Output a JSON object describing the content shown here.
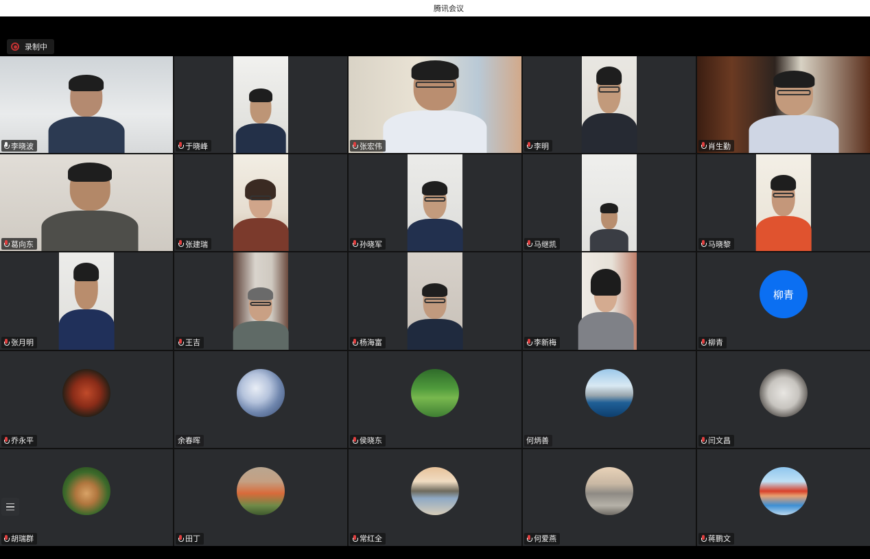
{
  "app": {
    "title": "腾讯会议"
  },
  "recording": {
    "label": "录制中",
    "icon": "record-icon"
  },
  "participants": [
    {
      "name": "李晓波",
      "mic": "on"
    },
    {
      "name": "于晓峰",
      "mic": "muted"
    },
    {
      "name": "张宏伟",
      "mic": "muted"
    },
    {
      "name": "李明",
      "mic": "muted"
    },
    {
      "name": "肖生勤",
      "mic": "muted"
    },
    {
      "name": "葛向东",
      "mic": "muted"
    },
    {
      "name": "张建瑞",
      "mic": "muted"
    },
    {
      "name": "孙晓军",
      "mic": "muted"
    },
    {
      "name": "马继凯",
      "mic": "muted"
    },
    {
      "name": "马晓黎",
      "mic": "muted"
    },
    {
      "name": "张月明",
      "mic": "muted"
    },
    {
      "name": "王吉",
      "mic": "muted"
    },
    {
      "name": "杨海富",
      "mic": "muted"
    },
    {
      "name": "李新梅",
      "mic": "muted"
    },
    {
      "name": "柳青",
      "mic": "muted",
      "avatar_text": "柳青"
    },
    {
      "name": "乔永平",
      "mic": "muted"
    },
    {
      "name": "余春晖",
      "mic": "none"
    },
    {
      "name": "侯晓东",
      "mic": "muted"
    },
    {
      "name": "何炳善",
      "mic": "none"
    },
    {
      "name": "闫文昌",
      "mic": "muted"
    },
    {
      "name": "胡瑞群",
      "mic": "muted"
    },
    {
      "name": "田丁",
      "mic": "muted"
    },
    {
      "name": "常红全",
      "mic": "muted"
    },
    {
      "name": "何爱燕",
      "mic": "muted"
    },
    {
      "name": "蒋鹏文",
      "mic": "muted"
    }
  ],
  "controls": {
    "list_icon": "list-icon"
  }
}
